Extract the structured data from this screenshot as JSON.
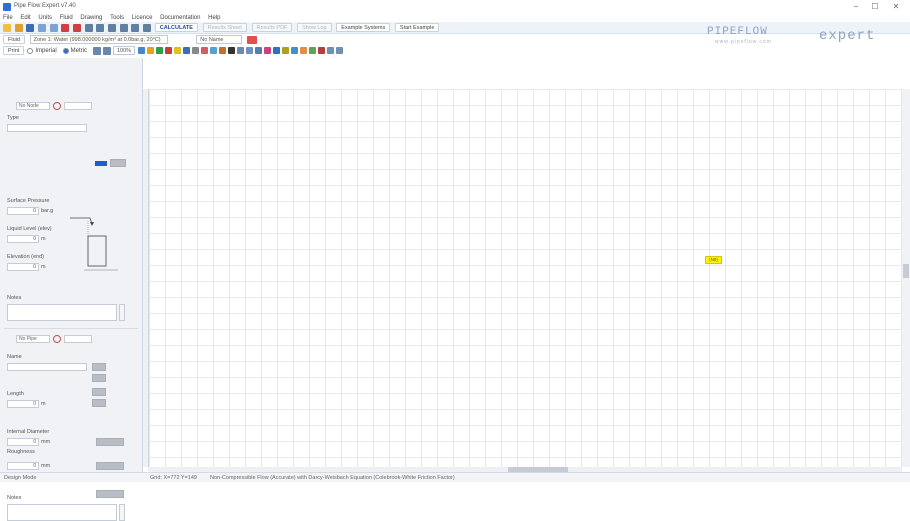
{
  "window": {
    "title": "Pipe Flow Expert v7.40",
    "minimize": "–",
    "maximize": "☐",
    "close": "✕"
  },
  "menu": [
    "File",
    "Edit",
    "Units",
    "Fluid",
    "Drawing",
    "Tools",
    "Licence",
    "Documentation",
    "Help"
  ],
  "toolbar": {
    "calculate_label": "CALCULATE",
    "results_sheet_label": "Results Sheet",
    "results_pdf_label": "Results PDF",
    "show_log_label": "Show Log",
    "example_systems_label": "Example Systems",
    "start_example_label": "Start Example",
    "fluid_zone_value": "Zone 1: Water (998.000000 kg/m³ at 0.0bar.g, 20°C)",
    "no_name_value": "No Name",
    "imperial_label": "Imperial",
    "metric_label": "Metric",
    "fluid_label": "Fluid",
    "zoom_value": "100%",
    "print_label": "Print"
  },
  "logo": {
    "pipeflow": "PIPEFLOW",
    "url": "www.pipeflow.com",
    "expert": "expert"
  },
  "node_panel": {
    "selector": "No Node",
    "type_label": "Type",
    "surface_pressure_label": "Surface Pressure",
    "surface_pressure_value": "0",
    "surface_pressure_unit": "bar.g",
    "liquid_level_label": "Liquid Level (elev)",
    "liquid_level_value": "0",
    "liquid_level_unit": "m",
    "elevation_label": "Elevation (end)",
    "elevation_value": "0",
    "elevation_unit": "m",
    "notes_label": "Notes"
  },
  "pipe_panel": {
    "selector": "No Pipe",
    "name_label": "Name",
    "length_label": "Length",
    "length_value": "0",
    "length_unit": "m",
    "internal_diameter_label": "Internal Diameter",
    "internal_diameter_value": "0",
    "internal_diameter_unit": "mm",
    "roughness_label": "Roughness",
    "roughness_value": "0",
    "roughness_unit": "mm",
    "notes_label": "Notes"
  },
  "canvas": {
    "node_label": "(N6)"
  },
  "status": {
    "mode": "Design Mode",
    "grid": "Grid: X=772 Y=149",
    "info": "Non-Compressible Flow (Accurate) with Darcy-Weisbach Equation (Colebrook-White Friction Factor)"
  },
  "colors": {
    "accent": "#2a6fdb",
    "canvas_grid": "#e6e8ec",
    "node_fill": "#fff200"
  }
}
